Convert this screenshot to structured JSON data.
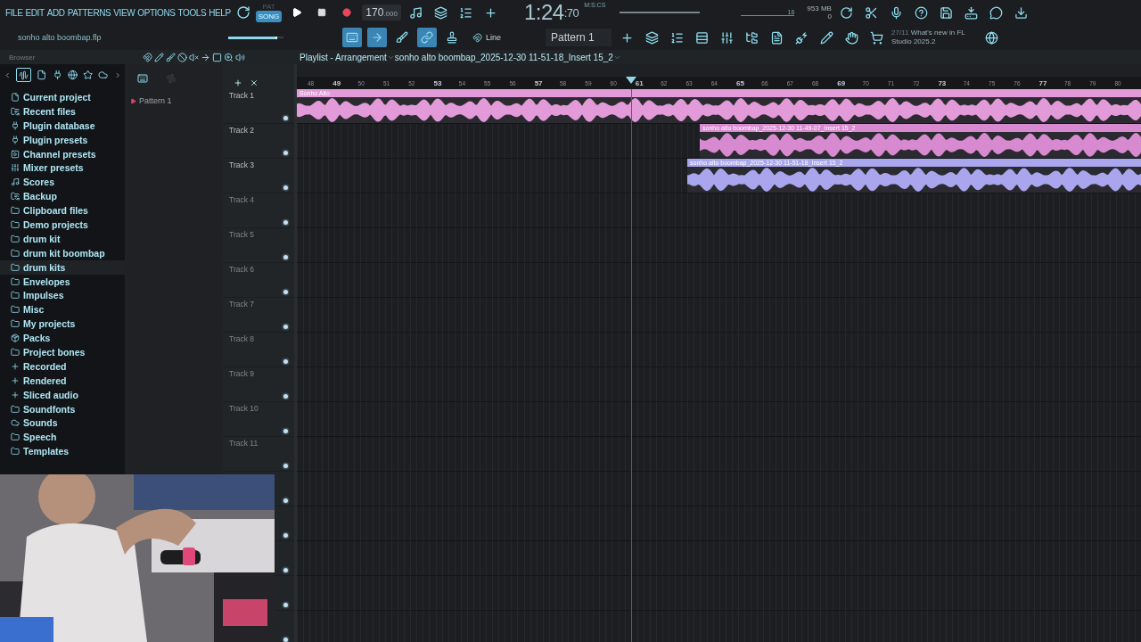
{
  "menu": [
    "FILE",
    "EDIT",
    "ADD",
    "PATTERNS",
    "VIEW",
    "OPTIONS",
    "TOOLS",
    "HELP"
  ],
  "transport": {
    "pat_label": "PAT",
    "song_label": "SONG",
    "song_selected": true,
    "tempo": "170",
    "tempo_fraction": ".000",
    "time": "1:24",
    "time_cs": ":70",
    "time_unit": "M:S:CS",
    "polyphony": "16",
    "memory": "953 MB",
    "voices": "0"
  },
  "hint": "sonho alto boombap.flp",
  "tools": [
    {
      "kind": "keyboard",
      "selected": true
    },
    {
      "kind": "arrow",
      "selected": true
    },
    {
      "kind": "brush",
      "selected": false
    },
    {
      "kind": "link",
      "selected": true
    },
    {
      "kind": "stamp",
      "selected": false
    }
  ],
  "master_volume": {
    "level": 0.85
  },
  "snap": "Line",
  "pattern": "Pattern 1",
  "news": {
    "date": "27/11",
    "text": "What's new in FL Studio 2025.2"
  },
  "browser": {
    "title": "Browser",
    "items": [
      {
        "label": "Current project",
        "kind": "project",
        "selected": false
      },
      {
        "label": "Recent files",
        "kind": "history",
        "selected": false
      },
      {
        "label": "Plugin database",
        "kind": "plugin",
        "selected": false
      },
      {
        "label": "Plugin presets",
        "kind": "plugin",
        "selected": false
      },
      {
        "label": "Channel presets",
        "kind": "channel",
        "selected": false
      },
      {
        "label": "Mixer presets",
        "kind": "mixer",
        "selected": false
      },
      {
        "label": "Scores",
        "kind": "score",
        "selected": false
      },
      {
        "label": "Backup",
        "kind": "history",
        "selected": false
      },
      {
        "label": "Clipboard files",
        "kind": "folder",
        "selected": false
      },
      {
        "label": "Demo projects",
        "kind": "folder",
        "selected": false
      },
      {
        "label": "drum kit",
        "kind": "folder",
        "selected": false
      },
      {
        "label": "drum kit boombap",
        "kind": "folder",
        "selected": false
      },
      {
        "label": "drum kits",
        "kind": "folder",
        "selected": true
      },
      {
        "label": "Envelopes",
        "kind": "folder",
        "selected": false
      },
      {
        "label": "Impulses",
        "kind": "folder",
        "selected": false
      },
      {
        "label": "Misc",
        "kind": "folder",
        "selected": false
      },
      {
        "label": "My projects",
        "kind": "folder",
        "selected": false
      },
      {
        "label": "Packs",
        "kind": "packs",
        "selected": false
      },
      {
        "label": "Project bones",
        "kind": "folder",
        "selected": false
      },
      {
        "label": "Recorded",
        "kind": "recorded",
        "selected": false
      },
      {
        "label": "Rendered",
        "kind": "recorded",
        "selected": false
      },
      {
        "label": "Sliced audio",
        "kind": "recorded",
        "selected": false
      },
      {
        "label": "Soundfonts",
        "kind": "folder",
        "selected": false
      },
      {
        "label": "Sounds",
        "kind": "cloud",
        "selected": false
      },
      {
        "label": "Speech",
        "kind": "folder",
        "selected": false
      },
      {
        "label": "Templates",
        "kind": "folder",
        "selected": false
      }
    ]
  },
  "patterns": [
    "Pattern 1"
  ],
  "playlist": {
    "title": "Playlist - Arrangement",
    "subtitle": "sonho alto boombap_2025-12-30 11-51-18_Insert 15_2",
    "bars": [
      {
        "label": "48",
        "major": false
      },
      {
        "label": "49",
        "major": true
      },
      {
        "label": "50",
        "major": false
      },
      {
        "label": "51",
        "major": false
      },
      {
        "label": "52",
        "major": false
      },
      {
        "label": "53",
        "major": true
      },
      {
        "label": "54",
        "major": false
      },
      {
        "label": "55",
        "major": false
      },
      {
        "label": "56",
        "major": false
      },
      {
        "label": "57",
        "major": true
      },
      {
        "label": "58",
        "major": false
      },
      {
        "label": "59",
        "major": false
      },
      {
        "label": "60",
        "major": false
      },
      {
        "label": "61",
        "major": true
      },
      {
        "label": "62",
        "major": false
      },
      {
        "label": "63",
        "major": false
      },
      {
        "label": "64",
        "major": false
      },
      {
        "label": "65",
        "major": true
      },
      {
        "label": "66",
        "major": false
      },
      {
        "label": "67",
        "major": false
      },
      {
        "label": "68",
        "major": false
      },
      {
        "label": "69",
        "major": true
      },
      {
        "label": "70",
        "major": false
      },
      {
        "label": "71",
        "major": false
      },
      {
        "label": "72",
        "major": false
      },
      {
        "label": "73",
        "major": true
      },
      {
        "label": "74",
        "major": false
      },
      {
        "label": "75",
        "major": false
      },
      {
        "label": "76",
        "major": false
      },
      {
        "label": "77",
        "major": true
      },
      {
        "label": "78",
        "major": false
      },
      {
        "label": "79",
        "major": false
      },
      {
        "label": "80",
        "major": false
      }
    ],
    "tracks": [
      {
        "name": "Track 1",
        "clip": {
          "label": "Sonho Alto",
          "color": "#e29ad8"
        }
      },
      {
        "name": "Track 2",
        "clip": {
          "label": "sonho alto boombap_2025-12-30 11-49-07_Insert 15_2",
          "color": "#d88ad0"
        }
      },
      {
        "name": "Track 3",
        "clip": {
          "label": "sonho alto boombap_2025-12-30 11-51-18_Insert 15_2",
          "color": "#a9a6ee"
        }
      },
      {
        "name": "Track 4"
      },
      {
        "name": "Track 5"
      },
      {
        "name": "Track 6"
      },
      {
        "name": "Track 7"
      },
      {
        "name": "Track 8"
      },
      {
        "name": "Track 9"
      },
      {
        "name": "Track 10"
      },
      {
        "name": "Track 11"
      }
    ]
  }
}
